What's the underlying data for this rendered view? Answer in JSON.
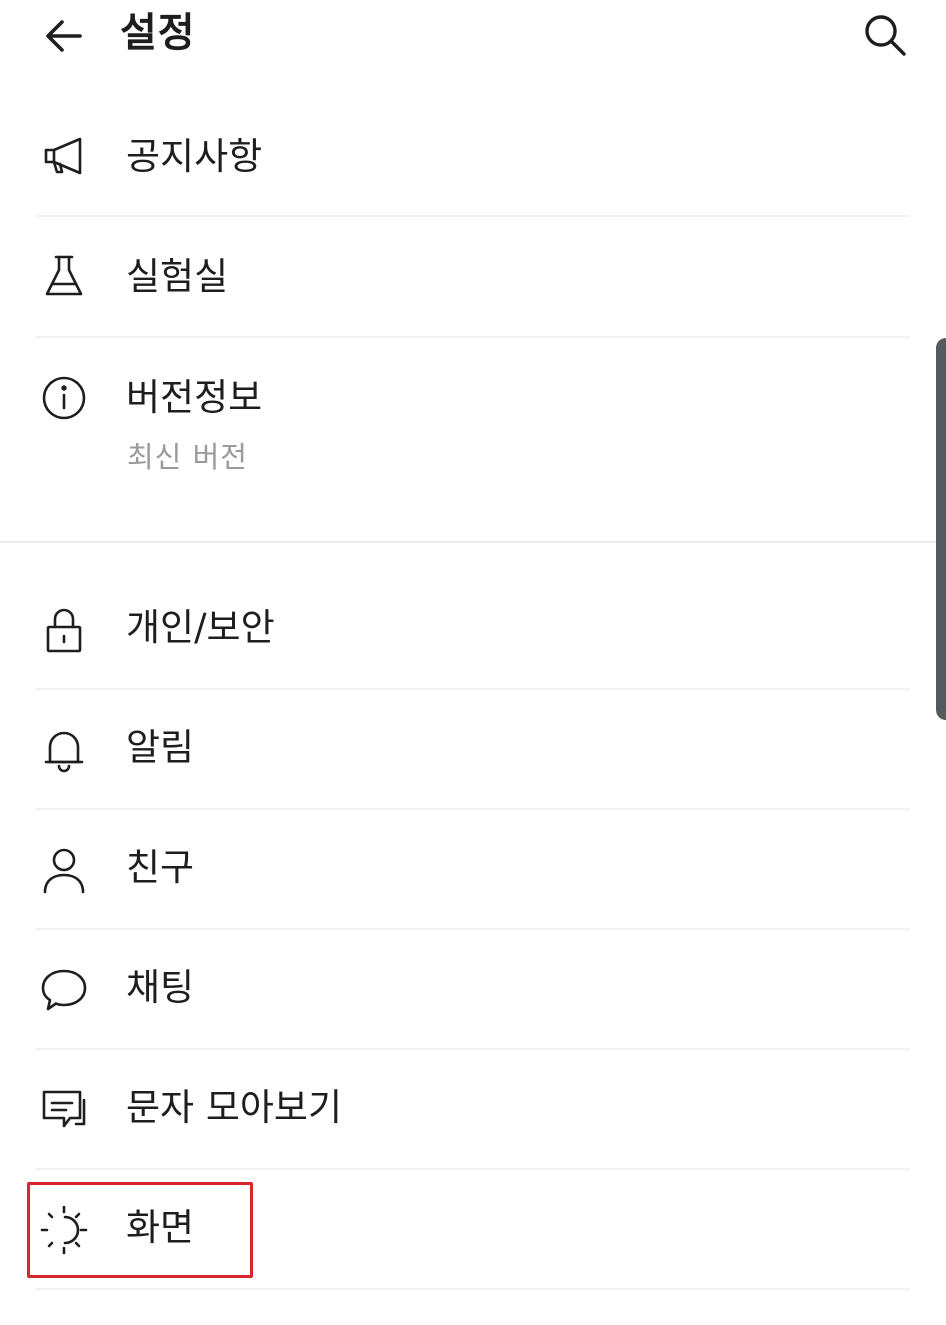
{
  "header": {
    "title": "설정",
    "back_icon": "arrow-left-icon",
    "search_icon": "search-icon"
  },
  "menu": [
    {
      "id": "notice",
      "label": "공지사항",
      "icon": "megaphone-icon"
    },
    {
      "id": "lab",
      "label": "실험실",
      "icon": "flask-icon"
    },
    {
      "id": "version",
      "label": "버전정보",
      "sub": "최신 버전",
      "icon": "info-icon"
    },
    {
      "id": "privacy",
      "label": "개인/보안",
      "icon": "lock-icon"
    },
    {
      "id": "notifications",
      "label": "알림",
      "icon": "bell-icon"
    },
    {
      "id": "friends",
      "label": "친구",
      "icon": "person-icon"
    },
    {
      "id": "chat",
      "label": "채팅",
      "icon": "chat-bubble-icon"
    },
    {
      "id": "sms",
      "label": "문자 모아보기",
      "icon": "message-box-icon"
    },
    {
      "id": "display",
      "label": "화면",
      "icon": "sun-moon-icon",
      "highlighted": true
    }
  ],
  "colors": {
    "highlight": "#d8262f",
    "text": "#1e1e1e",
    "subtext": "#9a9a9a"
  }
}
